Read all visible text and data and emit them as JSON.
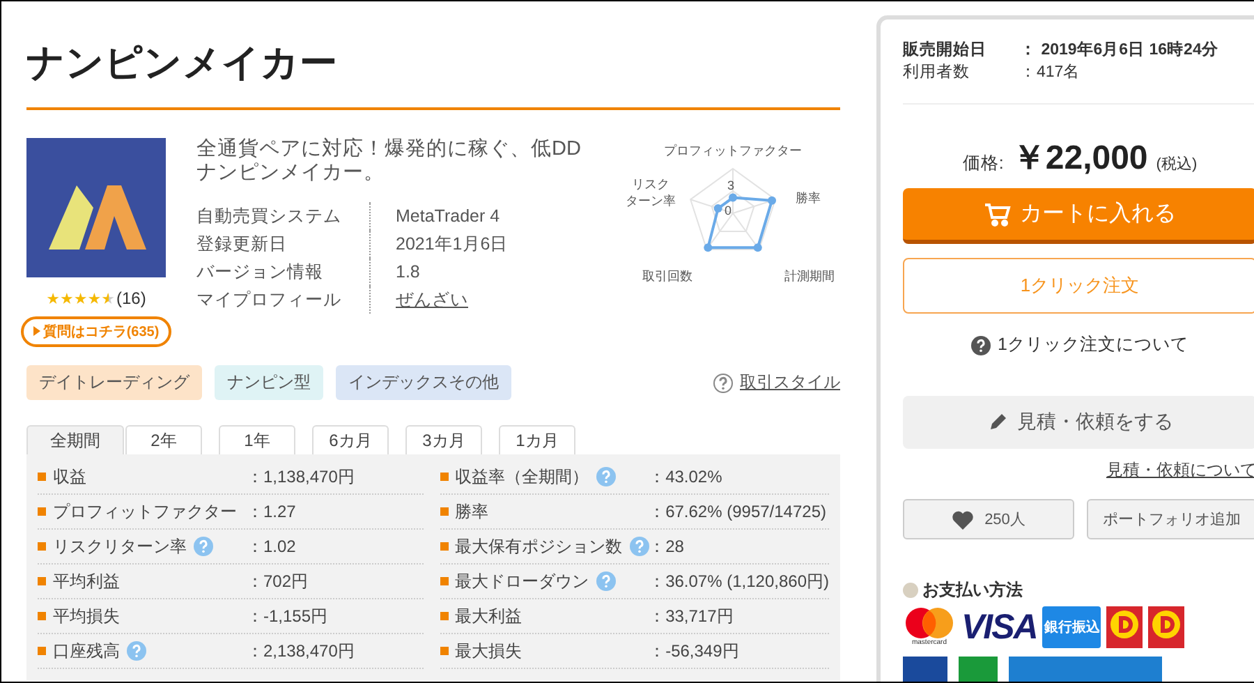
{
  "title": "ナンピンメイカー",
  "product": {
    "description": "全通貨ペアに対応！爆発的に稼ぐ、低DDナンピンメイカー。",
    "rating": {
      "stars": 4.5,
      "count": "(16)"
    },
    "question_button": "質問はコチラ(635)",
    "info": [
      {
        "label": "自動売買システム",
        "value": "MetaTrader 4",
        "kind": "text"
      },
      {
        "label": "登録更新日",
        "value": "2021年1月6日",
        "kind": "text"
      },
      {
        "label": "バージョン情報",
        "value": "1.8",
        "kind": "text"
      },
      {
        "label": "マイプロフィール",
        "value": "ぜんざい",
        "kind": "link"
      }
    ]
  },
  "radar": {
    "labels": [
      {
        "lines": [
          "プロフィットファクター"
        ]
      },
      {
        "lines": [
          "リスク",
          "ターン率"
        ]
      },
      {
        "lines": [
          "勝率"
        ]
      },
      {
        "lines": [
          "取引回数"
        ]
      },
      {
        "lines": [
          "計測期間"
        ]
      }
    ],
    "ticks": [
      "3",
      "0"
    ]
  },
  "tags": [
    {
      "label": "デイトレーディング",
      "color": "#fde3c8"
    },
    {
      "label": "ナンピン型",
      "color": "#dff3f5"
    },
    {
      "label": "インデックスその他",
      "color": "#dbe6f6"
    }
  ],
  "trade_style_link": "取引スタイル",
  "tabs": [
    {
      "label": "全期間",
      "selected": true
    },
    {
      "label": "2年",
      "selected": false
    },
    {
      "label": "1年",
      "selected": false
    },
    {
      "label": "6カ月",
      "selected": false
    },
    {
      "label": "3カ月",
      "selected": false
    },
    {
      "label": "1カ月",
      "selected": false
    }
  ],
  "stats_left": [
    {
      "label": "収益",
      "value": "：1,138,470円",
      "help": false
    },
    {
      "label": "プロフィットファクター",
      "value": "：1.27",
      "help": false
    },
    {
      "label": "リスクリターン率",
      "value": "：1.02",
      "help": true
    },
    {
      "label": "平均利益",
      "value": "：702円",
      "help": false
    },
    {
      "label": "平均損失",
      "value": "：-1,155円",
      "help": false
    },
    {
      "label": "口座残高",
      "value": "：2,138,470円",
      "help": true
    }
  ],
  "stats_right": [
    {
      "label": "収益率（全期間）",
      "value": "：43.02%",
      "help": true
    },
    {
      "label": "勝率",
      "value": "：67.62% (9957/14725)",
      "help": false
    },
    {
      "label": "最大保有ポジション数",
      "value": "：28",
      "help": true
    },
    {
      "label": "最大ドローダウン",
      "value": "：36.07% (1,120,860円)",
      "help": true
    },
    {
      "label": "最大利益",
      "value": "：33,717円",
      "help": false
    },
    {
      "label": "最大損失",
      "value": "：-56,349円",
      "help": false
    }
  ],
  "sidebar": {
    "meta": [
      {
        "label": "販売開始日",
        "value": "：  2019年6月6日 16時24分",
        "kind": "bold"
      },
      {
        "label": "利用者数",
        "value": "：417名",
        "kind": "plain"
      }
    ],
    "price_label": "価格:",
    "price": "￥22,000",
    "tax": "(税込)",
    "cart_button": "カートに入れる",
    "one_click_button": "1クリック注文",
    "one_click_help": "1クリック注文について",
    "quote_button": "見積・依頼をする",
    "quote_link": "見積・依頼について",
    "favorite_button": "250人",
    "portfolio_button": "ポートフォリオ追加",
    "payment_title": "お支払い方法",
    "payment_logos": [
      {
        "kind": "mastercard",
        "label": "mastercard"
      },
      {
        "kind": "visa",
        "label": "VISA"
      },
      {
        "kind": "bank",
        "label": "銀行振込"
      },
      {
        "kind": "d-badge"
      },
      {
        "kind": "d-badge"
      }
    ]
  }
}
